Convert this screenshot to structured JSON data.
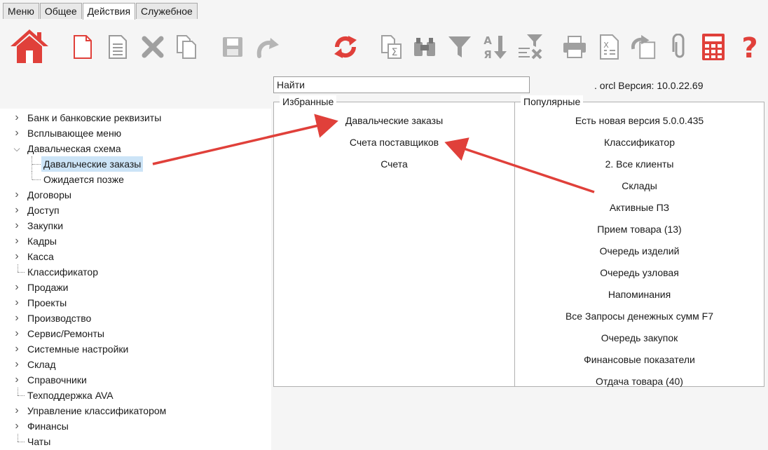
{
  "tabs": [
    "Меню",
    "Общее",
    "Действия",
    "Служебное"
  ],
  "active_tab": "Действия",
  "toolbar_icons": [
    "home-icon",
    "new-document-icon",
    "document-icon",
    "delete-icon",
    "copy-icon",
    "save-icon",
    "undo-icon",
    "refresh-icon",
    "sum-icon",
    "find-icon",
    "filter-icon",
    "sort-icon",
    "clear-filter-icon",
    "print-icon",
    "export-excel-icon",
    "redo-icon",
    "attach-icon",
    "calculator-icon",
    "help-icon"
  ],
  "search": {
    "value": "Найти"
  },
  "version_text": ". orcl Версия: 10.0.22.69",
  "tree": [
    {
      "label": "Банк и банковские реквизиты",
      "expandable": true
    },
    {
      "label": "Всплывающее меню",
      "expandable": true
    },
    {
      "label": "Давальческая схема",
      "expandable": true,
      "expanded": true
    },
    {
      "label": "Давальческие заказы",
      "child": true,
      "selected": true
    },
    {
      "label": "Ожидается позже",
      "child": true
    },
    {
      "label": "Договоры",
      "expandable": true
    },
    {
      "label": "Доступ",
      "expandable": true
    },
    {
      "label": "Закупки",
      "expandable": true
    },
    {
      "label": "Кадры",
      "expandable": true
    },
    {
      "label": "Касса",
      "expandable": true
    },
    {
      "label": "Классификатор",
      "expandable": false
    },
    {
      "label": "Продажи",
      "expandable": true
    },
    {
      "label": "Проекты",
      "expandable": true
    },
    {
      "label": "Производство",
      "expandable": true
    },
    {
      "label": "Сервис/Ремонты",
      "expandable": true
    },
    {
      "label": "Системные настройки",
      "expandable": true
    },
    {
      "label": "Склад",
      "expandable": true
    },
    {
      "label": "Справочники",
      "expandable": true
    },
    {
      "label": "Техподдержка AVA",
      "expandable": false
    },
    {
      "label": "Управление классификатором",
      "expandable": true
    },
    {
      "label": "Финансы",
      "expandable": true
    },
    {
      "label": "Чаты",
      "expandable": false
    }
  ],
  "favorites": {
    "title": "Избранные",
    "items": [
      "Давальческие заказы",
      "Счета поставщиков",
      "Счета"
    ]
  },
  "popular": {
    "title": "Популярные",
    "items": [
      "Есть новая версия 5.0.0.435",
      "Классификатор",
      "2. Все клиенты",
      "Склады",
      "Активные ПЗ",
      "Прием товара (13)",
      "Очередь изделий",
      "Очередь узловая",
      "Напоминания",
      "Все Запросы денежных сумм F7",
      "Очередь закупок",
      "Финансовые показатели",
      "Отдача товара (40)"
    ]
  },
  "colors": {
    "accent_red": "#e0403a",
    "selection": "#cce4f7"
  }
}
